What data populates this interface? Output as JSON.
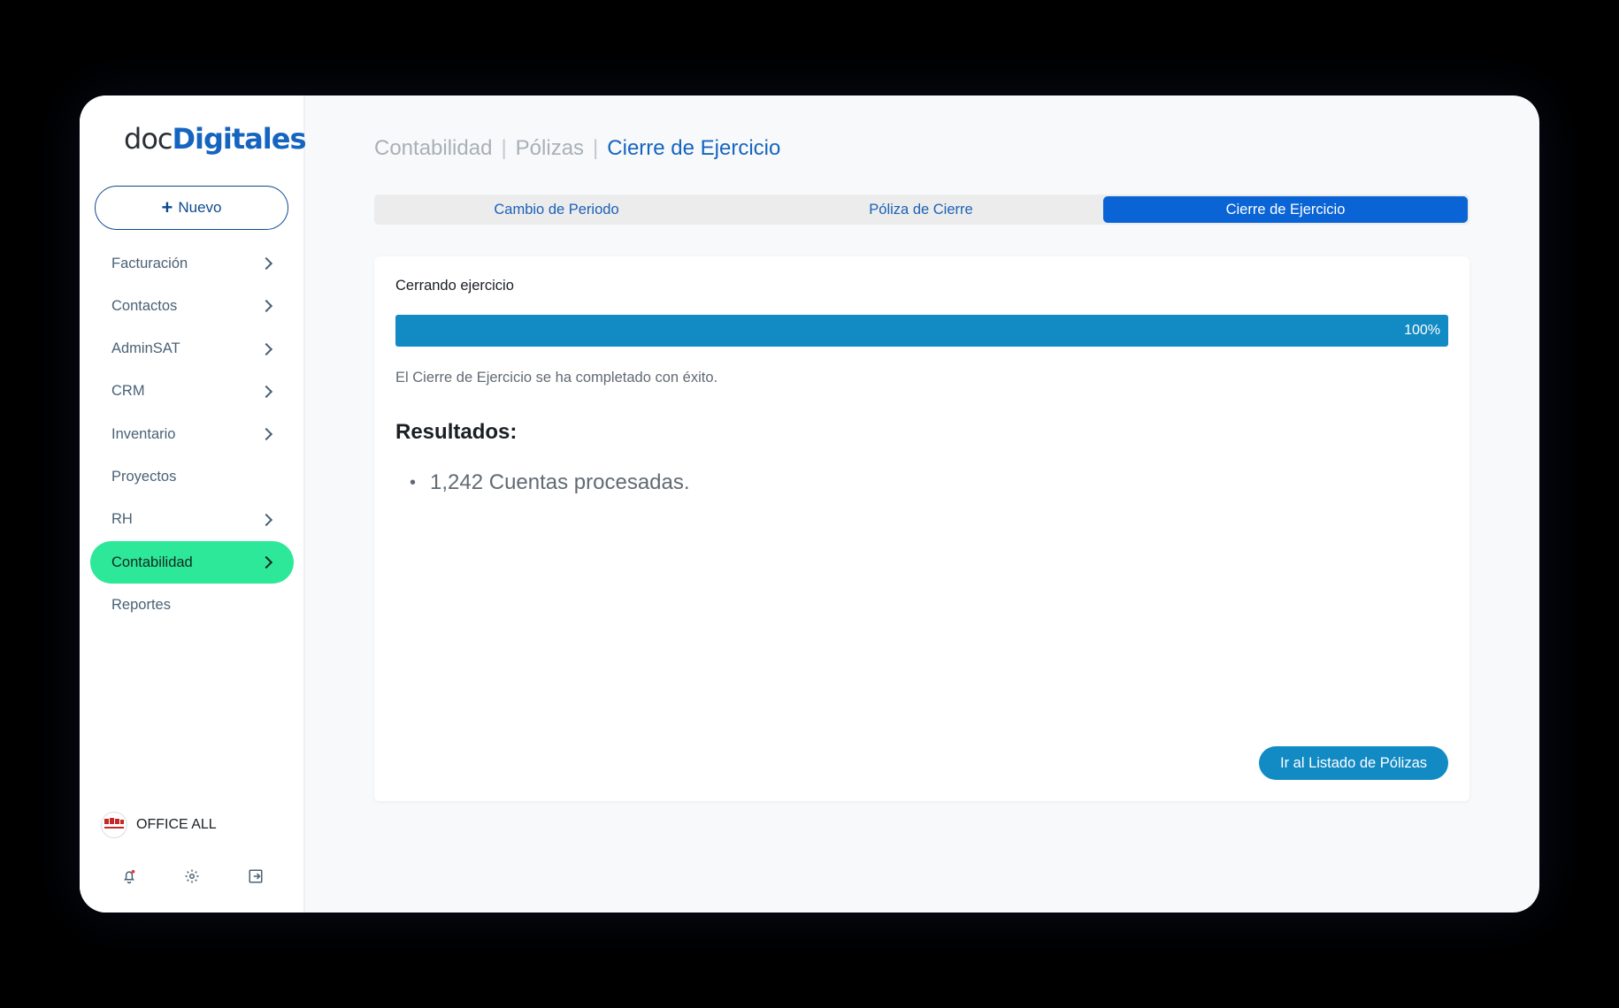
{
  "sidebar": {
    "logo": {
      "light": "doc",
      "bold": "Digitales"
    },
    "new_button": {
      "plus": "+",
      "label": "Nuevo"
    },
    "items": [
      {
        "label": "Facturación",
        "has_chevron": true
      },
      {
        "label": "Contactos",
        "has_chevron": true
      },
      {
        "label": "AdminSAT",
        "has_chevron": true
      },
      {
        "label": "CRM",
        "has_chevron": true
      },
      {
        "label": "Inventario",
        "has_chevron": true
      },
      {
        "label": "Proyectos",
        "has_chevron": false
      },
      {
        "label": "RH",
        "has_chevron": true
      },
      {
        "label": "Contabilidad",
        "has_chevron": true,
        "active": true
      },
      {
        "label": "Reportes",
        "has_chevron": false
      }
    ],
    "account": {
      "name": "OFFICE ALL",
      "logo_text": "OFFICE ALL"
    },
    "bottom_icons": [
      "bell-icon",
      "gear-icon",
      "logout-icon"
    ]
  },
  "header": {
    "breadcrumb": [
      "Contabilidad",
      "Pólizas",
      "Cierre de Ejercicio"
    ],
    "separator": "|"
  },
  "tabs": [
    {
      "label": "Cambio de Periodo",
      "active": false
    },
    {
      "label": "Póliza de Cierre",
      "active": false
    },
    {
      "label": "Cierre de Ejercicio",
      "active": true
    }
  ],
  "card": {
    "title": "Cerrando ejercicio",
    "progress": {
      "value": 1.0,
      "label": "100%"
    },
    "success_message": "El Cierre de Ejercicio se ha completado con éxito.",
    "results_title": "Resultados:",
    "results": [
      "1,242 Cuentas procesadas."
    ],
    "action_button": "Ir al Listado de Pólizas"
  },
  "colors": {
    "accent_blue": "#1565c0",
    "active_nav": "#2ee89a",
    "progress": "#128ac3",
    "tab_active": "#0a64d6"
  }
}
